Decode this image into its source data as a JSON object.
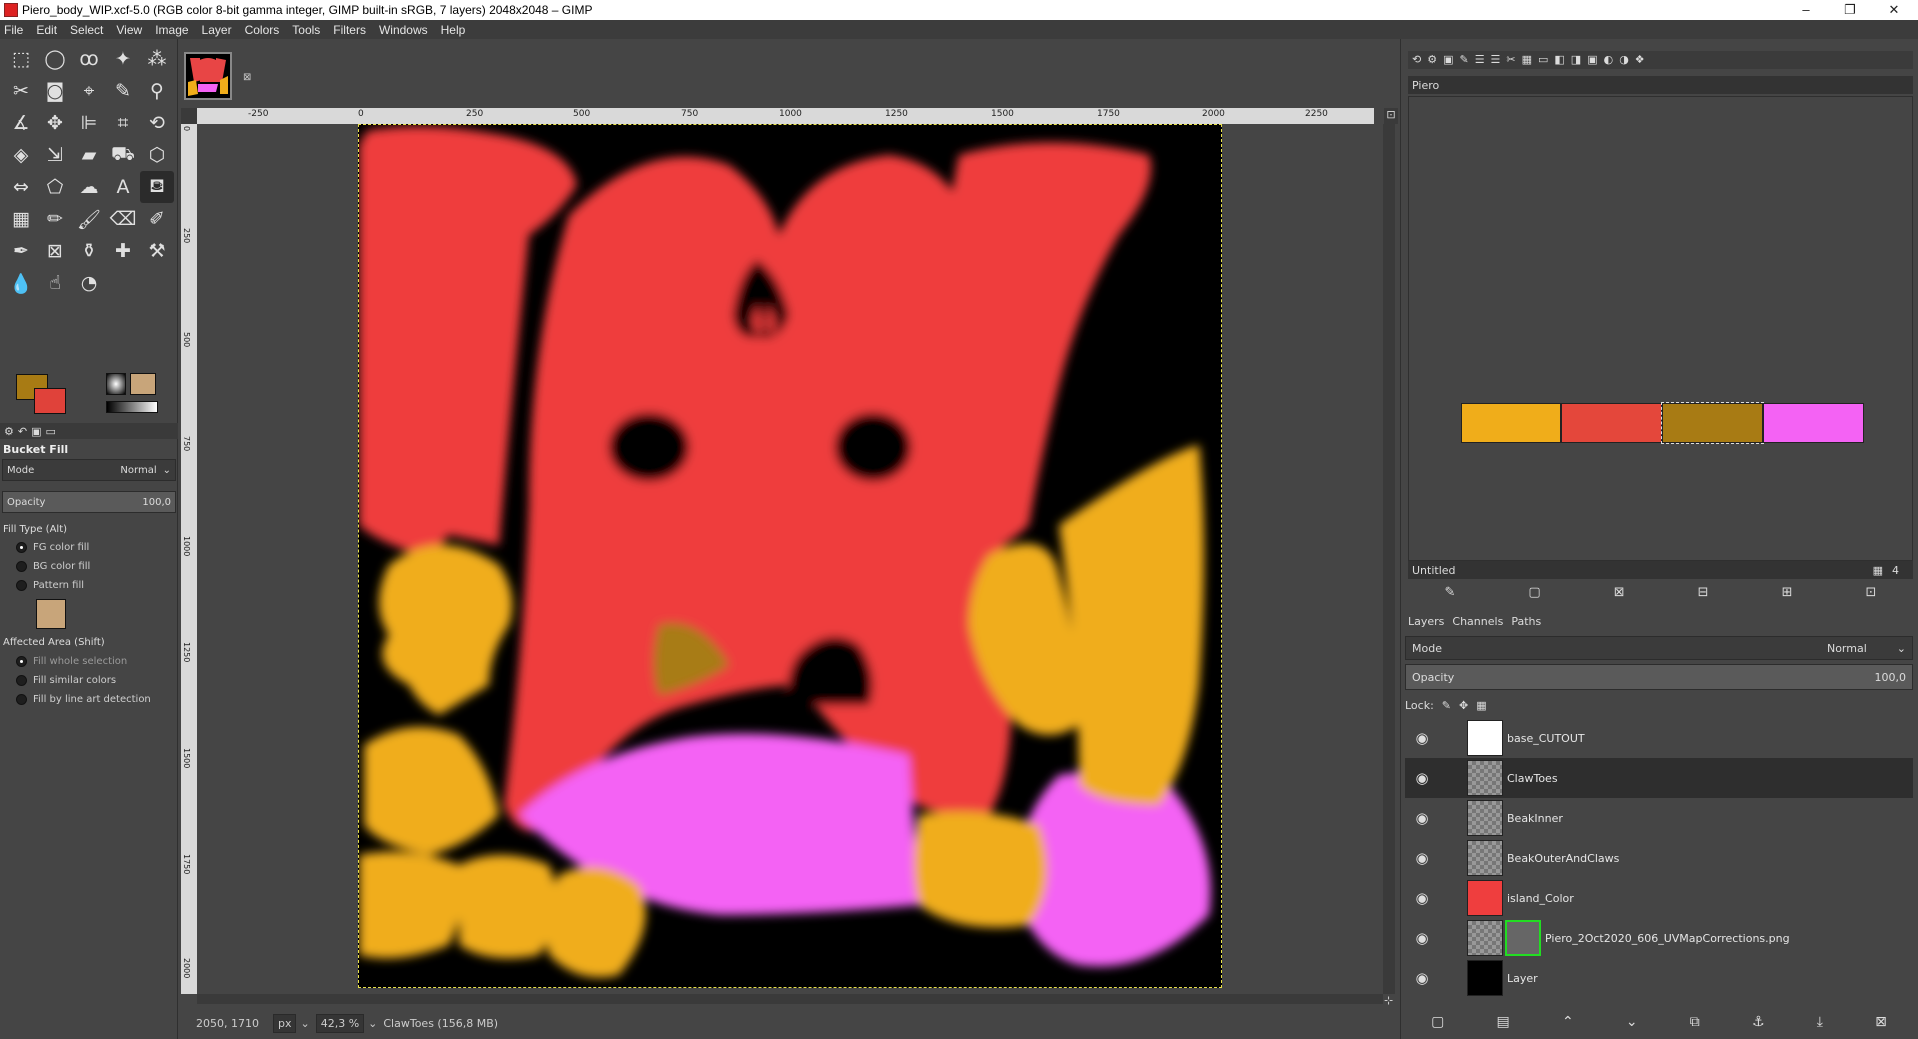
{
  "window": {
    "title": "Piero_body_WIP.xcf-5.0 (RGB color 8-bit gamma integer, GIMP built-in sRGB, 7 layers) 2048x2048 – GIMP",
    "minimize": "–",
    "restore": "❐",
    "close": "✕"
  },
  "menu": [
    "File",
    "Edit",
    "Select",
    "View",
    "Image",
    "Layer",
    "Colors",
    "Tools",
    "Filters",
    "Windows",
    "Help"
  ],
  "colors": {
    "fg": "#a87b14",
    "bg": "#e0423a"
  },
  "tool_options": {
    "title": "Bucket Fill",
    "mode_label": "Mode",
    "mode_value": "Normal",
    "opacity_label": "Opacity",
    "opacity_value": "100,0",
    "fill_type_label": "Fill Type  (Alt)",
    "fill_types": [
      "FG color fill",
      "BG color fill",
      "Pattern fill"
    ],
    "affected_label": "Affected Area  (Shift)",
    "affected": [
      "Fill whole selection",
      "Fill similar colors",
      "Fill by line art detection"
    ]
  },
  "ruler": {
    "h_ticks": [
      "-250",
      "0",
      "250",
      "500",
      "750",
      "1000",
      "1250",
      "1500",
      "1750",
      "2000",
      "2250"
    ],
    "v_ticks": [
      "0",
      "250",
      "500",
      "750",
      "1000",
      "1250",
      "1500",
      "1750",
      "2000"
    ]
  },
  "status": {
    "coords": "2050, 1710",
    "unit": "px",
    "zoom": "42,3 %",
    "info": "ClawToes (156,8 MB)"
  },
  "palette": {
    "name": "Piero",
    "footer_name": "Untitled",
    "columns": "4",
    "swatches": [
      "#f0ad1a",
      "#e4473b",
      "#a87b14",
      "#f462f4"
    ]
  },
  "layers_panel": {
    "tabs": [
      "Layers",
      "Channels",
      "Paths"
    ],
    "mode_label": "Mode",
    "mode_value": "Normal",
    "opacity_label": "Opacity",
    "opacity_value": "100,0",
    "lock_label": "Lock:",
    "layers": [
      {
        "name": "base_CUTOUT"
      },
      {
        "name": "ClawToes"
      },
      {
        "name": "BeakInner"
      },
      {
        "name": "BeakOuterAndClaws"
      },
      {
        "name": "island_Color"
      },
      {
        "name": "Piero_2Oct2020_606_UVMapCorrections.png"
      },
      {
        "name": "Layer"
      }
    ]
  }
}
